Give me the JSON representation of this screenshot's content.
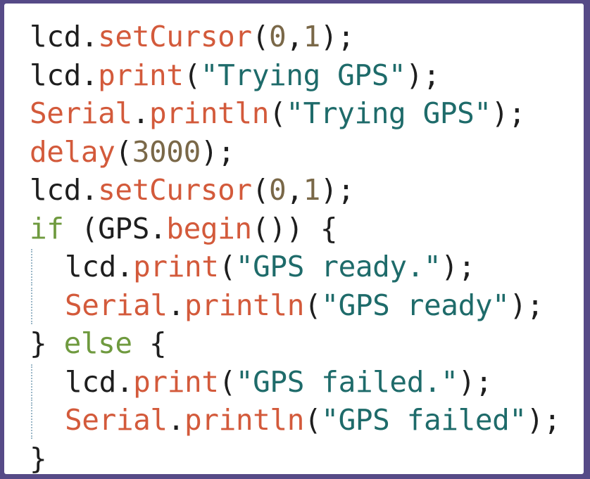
{
  "code_lines": [
    {
      "tokens": [
        {
          "text": "lcd.",
          "kind": "plain"
        },
        {
          "text": "setCursor",
          "kind": "fn"
        },
        {
          "text": "(",
          "kind": "plain"
        },
        {
          "text": "0",
          "kind": "num"
        },
        {
          "text": ",",
          "kind": "plain"
        },
        {
          "text": "1",
          "kind": "num"
        },
        {
          "text": ");",
          "kind": "plain"
        }
      ]
    },
    {
      "tokens": [
        {
          "text": "lcd.",
          "kind": "plain"
        },
        {
          "text": "print",
          "kind": "fn"
        },
        {
          "text": "(",
          "kind": "plain"
        },
        {
          "text": "\"Trying GPS\"",
          "kind": "str"
        },
        {
          "text": ");",
          "kind": "plain"
        }
      ]
    },
    {
      "tokens": [
        {
          "text": "Serial",
          "kind": "fn"
        },
        {
          "text": ".",
          "kind": "plain"
        },
        {
          "text": "println",
          "kind": "fn"
        },
        {
          "text": "(",
          "kind": "plain"
        },
        {
          "text": "\"Trying GPS\"",
          "kind": "str"
        },
        {
          "text": ");",
          "kind": "plain"
        }
      ]
    },
    {
      "tokens": [
        {
          "text": "delay",
          "kind": "fn"
        },
        {
          "text": "(",
          "kind": "plain"
        },
        {
          "text": "3000",
          "kind": "num"
        },
        {
          "text": ");",
          "kind": "plain"
        }
      ]
    },
    {
      "tokens": [
        {
          "text": "lcd.",
          "kind": "plain"
        },
        {
          "text": "setCursor",
          "kind": "fn"
        },
        {
          "text": "(",
          "kind": "plain"
        },
        {
          "text": "0",
          "kind": "num"
        },
        {
          "text": ",",
          "kind": "plain"
        },
        {
          "text": "1",
          "kind": "num"
        },
        {
          "text": ");",
          "kind": "plain"
        }
      ]
    },
    {
      "tokens": [
        {
          "text": "if",
          "kind": "ctrl"
        },
        {
          "text": " (GPS.",
          "kind": "plain"
        },
        {
          "text": "begin",
          "kind": "fn"
        },
        {
          "text": "()) {",
          "kind": "plain"
        }
      ]
    },
    {
      "indent": true,
      "tokens": [
        {
          "text": "lcd.",
          "kind": "plain"
        },
        {
          "text": "print",
          "kind": "fn"
        },
        {
          "text": "(",
          "kind": "plain"
        },
        {
          "text": "\"GPS ready.\"",
          "kind": "str"
        },
        {
          "text": ");",
          "kind": "plain"
        }
      ]
    },
    {
      "indent": true,
      "tokens": [
        {
          "text": "Serial",
          "kind": "fn"
        },
        {
          "text": ".",
          "kind": "plain"
        },
        {
          "text": "println",
          "kind": "fn"
        },
        {
          "text": "(",
          "kind": "plain"
        },
        {
          "text": "\"GPS ready\"",
          "kind": "str"
        },
        {
          "text": ");",
          "kind": "plain"
        }
      ]
    },
    {
      "tokens": [
        {
          "text": "} ",
          "kind": "plain"
        },
        {
          "text": "else",
          "kind": "ctrl"
        },
        {
          "text": " {",
          "kind": "plain"
        }
      ]
    },
    {
      "indent": true,
      "tokens": [
        {
          "text": "lcd.",
          "kind": "plain"
        },
        {
          "text": "print",
          "kind": "fn"
        },
        {
          "text": "(",
          "kind": "plain"
        },
        {
          "text": "\"GPS failed.\"",
          "kind": "str"
        },
        {
          "text": ");",
          "kind": "plain"
        }
      ]
    },
    {
      "indent": true,
      "tokens": [
        {
          "text": "Serial",
          "kind": "fn"
        },
        {
          "text": ".",
          "kind": "plain"
        },
        {
          "text": "println",
          "kind": "fn"
        },
        {
          "text": "(",
          "kind": "plain"
        },
        {
          "text": "\"GPS failed\"",
          "kind": "str"
        },
        {
          "text": ");",
          "kind": "plain"
        }
      ]
    },
    {
      "tokens": [
        {
          "text": "}",
          "kind": "plain"
        }
      ]
    }
  ],
  "colors": {
    "frame_border": "#564a87",
    "background": "#ffffff",
    "function": "#d35a3b",
    "control_keyword": "#6f9a3f",
    "string": "#1e6b6a",
    "number": "#7a6848",
    "plain": "#1e1e1e",
    "indent_guide": "#9bb7c7"
  }
}
